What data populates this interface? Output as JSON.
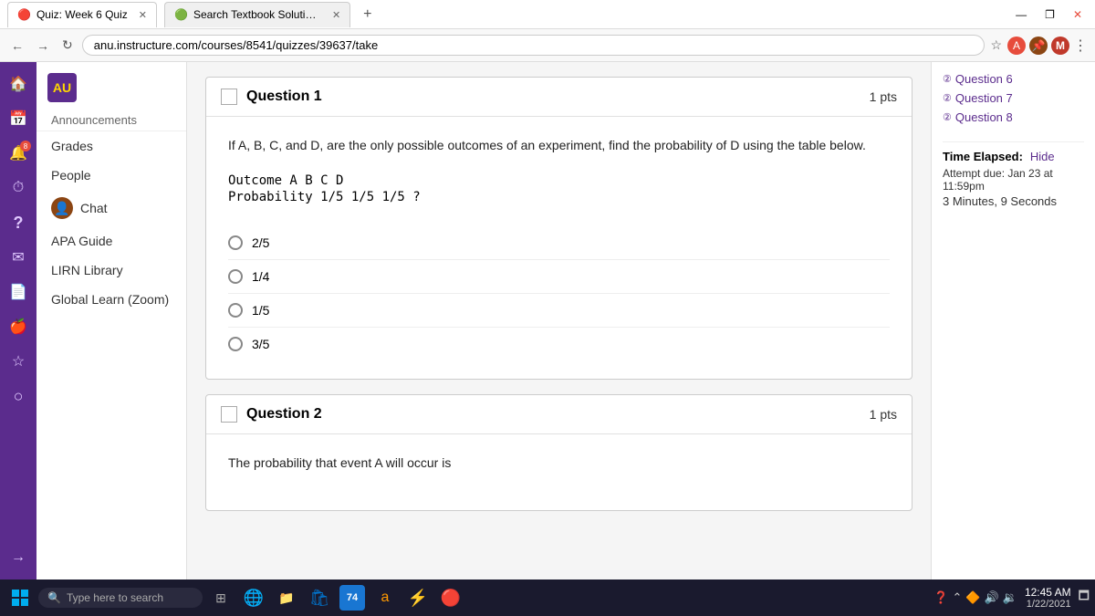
{
  "browser": {
    "tabs": [
      {
        "id": "quiz-tab",
        "label": "Quiz: Week 6 Quiz",
        "icon": "🔴",
        "active": true
      },
      {
        "id": "textbook-tab",
        "label": "Search Textbook Solutions | Che...",
        "icon": "🟢",
        "active": false
      }
    ],
    "url": "anu.instructure.com/courses/8541/quizzes/39637/take",
    "window_controls": [
      "—",
      "❐",
      "✕"
    ]
  },
  "left_nav": {
    "logo_text": "AU",
    "items": [
      {
        "id": "announcements",
        "label": "Announcements"
      },
      {
        "id": "grades",
        "label": "Grades"
      },
      {
        "id": "people",
        "label": "People"
      },
      {
        "id": "chat",
        "label": "Chat"
      },
      {
        "id": "apa-guide",
        "label": "APA Guide"
      },
      {
        "id": "lirn-library",
        "label": "LIRN Library"
      },
      {
        "id": "global-learn",
        "label": "Global Learn (Zoom)"
      }
    ]
  },
  "icon_sidebar": {
    "icons": [
      {
        "id": "home",
        "symbol": "🏠"
      },
      {
        "id": "calendar",
        "symbol": "📅"
      },
      {
        "id": "notifications",
        "symbol": "🔔",
        "badge": "8"
      },
      {
        "id": "clock",
        "symbol": "⏱"
      },
      {
        "id": "help",
        "symbol": "?"
      },
      {
        "id": "mail",
        "symbol": "✉"
      },
      {
        "id": "document",
        "symbol": "📄"
      },
      {
        "id": "apple",
        "symbol": "🍎"
      },
      {
        "id": "star",
        "symbol": "☆"
      },
      {
        "id": "circle",
        "symbol": "○"
      },
      {
        "id": "arrow",
        "symbol": "→"
      }
    ]
  },
  "right_sidebar": {
    "question_links": [
      {
        "id": "q6",
        "label": "Question 6"
      },
      {
        "id": "q7",
        "label": "Question 7"
      },
      {
        "id": "q8",
        "label": "Question 8"
      }
    ],
    "time_section": {
      "label": "Time Elapsed:",
      "hide_label": "Hide",
      "attempt_due": "Attempt due: Jan 23 at 11:59pm",
      "time_count": "3 Minutes, 9 Seconds"
    }
  },
  "questions": [
    {
      "id": "q1",
      "number": "Question 1",
      "points": "1 pts",
      "text": "If A, B, C, and D, are the only possible outcomes of an experiment, find the probability of D using the table below.",
      "table": {
        "row1": "Outcome   A   B   C   D",
        "row2": "Probability 1/5 1/5 1/5  ?"
      },
      "options": [
        {
          "id": "opt1",
          "value": "2/5"
        },
        {
          "id": "opt2",
          "value": "1/4"
        },
        {
          "id": "opt3",
          "value": "1/5"
        },
        {
          "id": "opt4",
          "value": "3/5"
        }
      ]
    },
    {
      "id": "q2",
      "number": "Question 2",
      "points": "1 pts",
      "text": "The probability that event A will occur is"
    }
  ],
  "taskbar": {
    "search_placeholder": "Type here to search",
    "clock_time": "12:45 AM",
    "clock_date": "1/22/2021",
    "pinned_label": "74"
  }
}
